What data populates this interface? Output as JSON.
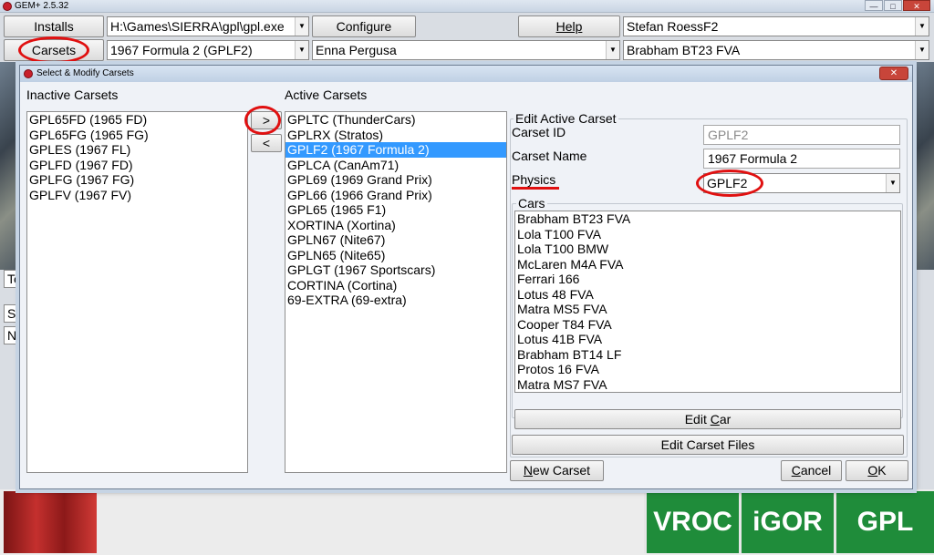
{
  "app": {
    "title": "GEM+ 2.5.32"
  },
  "toolbar": {
    "installs_label": "Installs",
    "carsets_label": "Carsets",
    "install_path": "H:\\Games\\SIERRA\\gpl\\gpl.exe",
    "configure_label": "Configure",
    "help_label": "Help",
    "driver": "Stefan RoessF2",
    "carset": "1967 Formula 2 (GPLF2)",
    "track": "Enna Pergusa",
    "car": "Brabham BT23 FVA"
  },
  "background": {
    "cells": [
      "Te",
      "Sh",
      "No"
    ]
  },
  "dialog": {
    "title": "Select & Modify Carsets",
    "inactive_label": "Inactive Carsets",
    "inactive_items": [
      "GPL65FD (1965 FD)",
      "GPL65FG (1965 FG)",
      "GPLES (1967 FL)",
      "GPLFD (1967 FD)",
      "GPLFG (1967 FG)",
      "GPLFV (1967 FV)"
    ],
    "move_right_label": ">",
    "move_left_label": "<",
    "active_label": "Active Carsets",
    "active_items": [
      "GPLTC (ThunderCars)",
      "GPLRX (Stratos)",
      "GPLF2 (1967 Formula 2)",
      "GPLCA (CanAm71)",
      "GPL69 (1969 Grand Prix)",
      "GPL66 (1966 Grand Prix)",
      "GPL65 (1965 F1)",
      "XORTINA (Xortina)",
      "GPLN67 (Nite67)",
      "GPLN65 (Nite65)",
      "GPLGT (1967 Sportscars)",
      "CORTINA (Cortina)",
      "69-EXTRA (69-extra)"
    ],
    "active_selected_index": 2,
    "edit_group_title": "Edit Active Carset",
    "carset_id_label": "Carset ID",
    "carset_id_value": "GPLF2",
    "carset_name_label": "Carset Name",
    "carset_name_value": "1967 Formula 2",
    "physics_label": "Physics",
    "physics_value": "GPLF2",
    "cars_label": "Cars",
    "cars": [
      "Brabham BT23 FVA",
      "Lola T100 FVA",
      "Lola T100 BMW",
      "McLaren M4A FVA",
      "Ferrari 166",
      "Lotus 48 FVA",
      "Matra MS5 FVA",
      "Cooper T84 FVA",
      "Lotus 41B FVA",
      "Brabham BT14 LF",
      "Protos 16 FVA",
      "Matra MS7 FVA"
    ],
    "edit_car_pre": "Edit ",
    "edit_car_mn": "C",
    "edit_car_post": "ar",
    "edit_carset_files_label": "Edit Carset Files",
    "new_carset_pre": "",
    "new_carset_mn": "N",
    "new_carset_post": "ew Carset",
    "cancel_pre": "",
    "cancel_mn": "C",
    "cancel_post": "ancel",
    "ok_pre": "",
    "ok_mn": "O",
    "ok_post": "K"
  },
  "logos": [
    "VROC",
    "iGOR",
    "GPL"
  ],
  "colors": {
    "selection": "#3399ff",
    "annotation": "#e01010",
    "logo_green": "#1f8c3a"
  }
}
